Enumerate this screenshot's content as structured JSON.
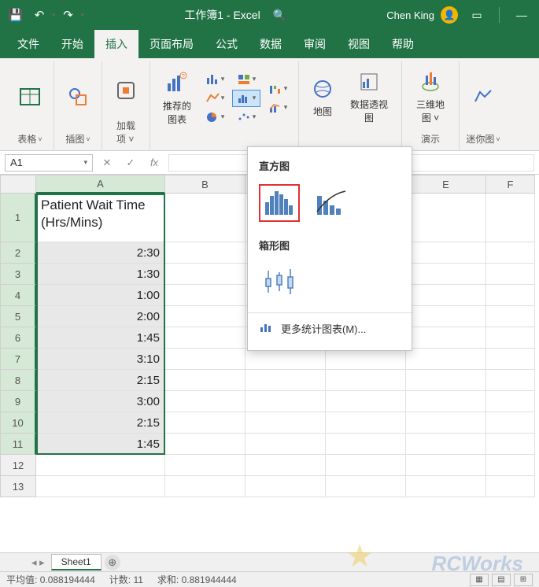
{
  "titlebar": {
    "doc_title": "工作簿1 - Excel",
    "user_name": "Chen King"
  },
  "tabs": {
    "file": "文件",
    "home": "开始",
    "insert": "插入",
    "pagelayout": "页面布局",
    "formulas": "公式",
    "data": "数据",
    "review": "审阅",
    "view": "视图",
    "help": "帮助"
  },
  "ribbon": {
    "tables": "表格",
    "illustrations": "插图",
    "addins": "加载\n项 ˅",
    "recommended_charts": "推荐的\n图表",
    "maps": "地图",
    "pivotchart": "数据透视图",
    "threed_map": "三维地\n图 ˅",
    "sparklines": "迷你图",
    "tours": "演示"
  },
  "namebox": "A1",
  "columns": [
    "A",
    "B",
    "C",
    "D",
    "E",
    "F"
  ],
  "header_cell": "Patient Wait Time (Hrs/Mins)",
  "data_col": [
    "2:30",
    "1:30",
    "1:00",
    "2:00",
    "1:45",
    "3:10",
    "2:15",
    "3:00",
    "2:15",
    "1:45"
  ],
  "popup": {
    "histogram": "直方图",
    "boxplot": "箱形图",
    "more": "更多统计图表(M)..."
  },
  "sheet": {
    "name": "Sheet1"
  },
  "status": {
    "avg_label": "平均值:",
    "avg": "0.088194444",
    "count_label": "计数:",
    "count": "11",
    "sum_label": "求和:",
    "sum": "0.881944444"
  },
  "watermark": "RCWorks"
}
